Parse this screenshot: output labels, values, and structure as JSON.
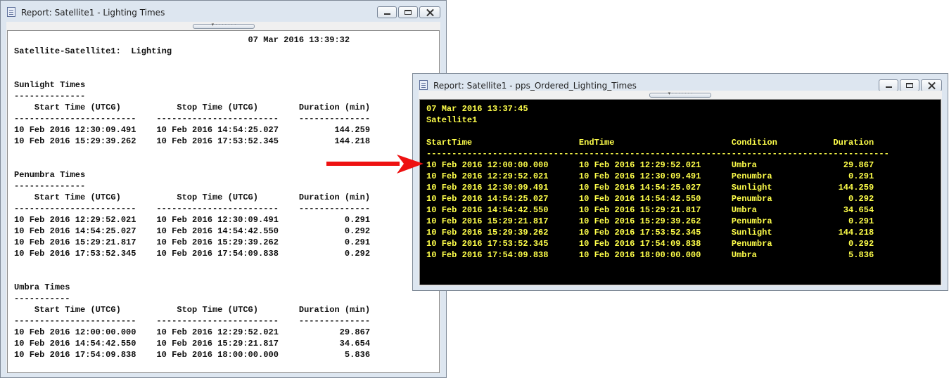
{
  "window1": {
    "title": "Report:  Satellite1 - Lighting Times",
    "report_lines": [
      "                                              07 Mar 2016 13:39:32",
      "Satellite-Satellite1:  Lighting",
      "",
      "",
      "Sunlight Times",
      "--------------",
      "    Start Time (UTCG)           Stop Time (UTCG)        Duration (min)",
      "------------------------    ------------------------    --------------",
      "10 Feb 2016 12:30:09.491    10 Feb 2016 14:54:25.027           144.259",
      "10 Feb 2016 15:29:39.262    10 Feb 2016 17:53:52.345           144.218",
      "",
      "",
      "Penumbra Times",
      "--------------",
      "    Start Time (UTCG)           Stop Time (UTCG)        Duration (min)",
      "------------------------    ------------------------    --------------",
      "10 Feb 2016 12:29:52.021    10 Feb 2016 12:30:09.491             0.291",
      "10 Feb 2016 14:54:25.027    10 Feb 2016 14:54:42.550             0.292",
      "10 Feb 2016 15:29:21.817    10 Feb 2016 15:29:39.262             0.291",
      "10 Feb 2016 17:53:52.345    10 Feb 2016 17:54:09.838             0.292",
      "",
      "",
      "Umbra Times",
      "-----------",
      "    Start Time (UTCG)           Stop Time (UTCG)        Duration (min)",
      "------------------------    ------------------------    --------------",
      "10 Feb 2016 12:00:00.000    10 Feb 2016 12:29:52.021            29.867",
      "10 Feb 2016 14:54:42.550    10 Feb 2016 15:29:21.817            34.654",
      "10 Feb 2016 17:54:09.838    10 Feb 2016 18:00:00.000             5.836"
    ]
  },
  "window2": {
    "title": "Report:  Satellite1 - pps_Ordered_Lighting_Times",
    "report_lines": [
      "07 Mar 2016 13:37:45",
      "Satellite1",
      "",
      "StartTime                     EndTime                       Condition           Duration",
      "-------------------------------------------------------------------------------------------",
      "10 Feb 2016 12:00:00.000      10 Feb 2016 12:29:52.021      Umbra                 29.867",
      "10 Feb 2016 12:29:52.021      10 Feb 2016 12:30:09.491      Penumbra               0.291",
      "10 Feb 2016 12:30:09.491      10 Feb 2016 14:54:25.027      Sunlight             144.259",
      "10 Feb 2016 14:54:25.027      10 Feb 2016 14:54:42.550      Penumbra               0.292",
      "10 Feb 2016 14:54:42.550      10 Feb 2016 15:29:21.817      Umbra                 34.654",
      "10 Feb 2016 15:29:21.817      10 Feb 2016 15:29:39.262      Penumbra               0.291",
      "10 Feb 2016 15:29:39.262      10 Feb 2016 17:53:52.345      Sunlight             144.218",
      "10 Feb 2016 17:53:52.345      10 Feb 2016 17:54:09.838      Penumbra               0.292",
      "10 Feb 2016 17:54:09.838      10 Feb 2016 18:00:00.000      Umbra                  5.836"
    ]
  },
  "colors": {
    "report2_text": "#ffff4a",
    "report2_background": "#000000",
    "arrow": "#ee1111"
  },
  "icons": {
    "window_icon": "report-document-icon",
    "minimize": "minimize-icon",
    "maximize": "maximize-icon",
    "close": "close-icon",
    "annotation": "red-arrow-icon"
  }
}
